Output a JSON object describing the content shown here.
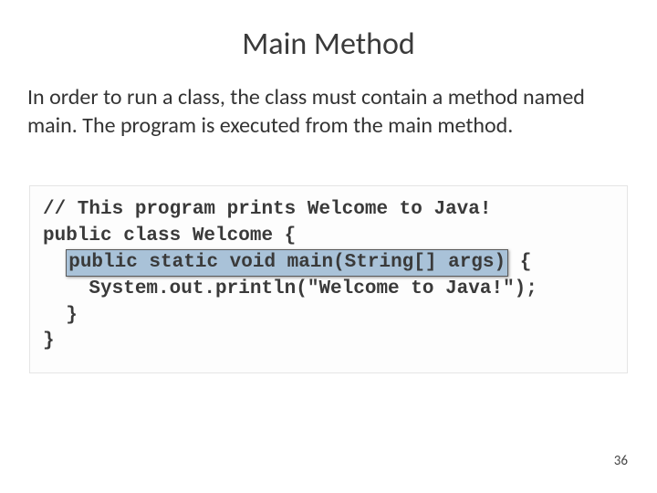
{
  "title": "Main Method",
  "description": "In order to run a class, the class must contain a method named main. The program is executed from the main method.",
  "code": {
    "line1": "// This program prints Welcome to Java! ",
    "line2": "public class Welcome { ",
    "line3_indent": "  ",
    "line3_highlight": "public static void main(String[] args)",
    "line3_after": " { ",
    "line4": "    System.out.println(\"Welcome to Java!\");",
    "line5": "  } ",
    "line6": "}"
  },
  "page_number": "36"
}
